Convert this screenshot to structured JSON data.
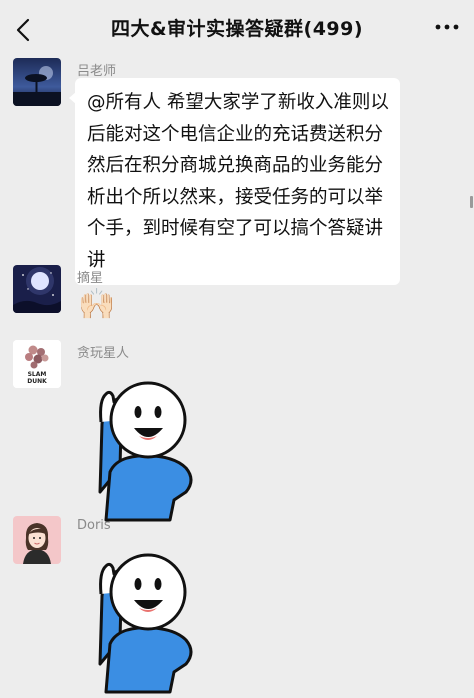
{
  "header": {
    "title": "四大&审计实操答疑群(499)"
  },
  "messages": [
    {
      "sender": "吕老师",
      "text": "@所有人  希望大家学了新收入准则以后能对这个电信企业的充话费送积分然后在积分商城兑换商品的业务能分析出个所以然来，接受任务的可以举个手，到时候有空了可以搞个答疑讲讲"
    },
    {
      "sender": "摘星",
      "emoji": "🙌🏻"
    },
    {
      "sender": "贪玩星人",
      "avatar_text": "SLAM DUNK"
    },
    {
      "sender": "Doris"
    }
  ],
  "colors": {
    "background": "#ededed",
    "bubble": "#ffffff",
    "sticker_blue": "#3b8ee3"
  }
}
